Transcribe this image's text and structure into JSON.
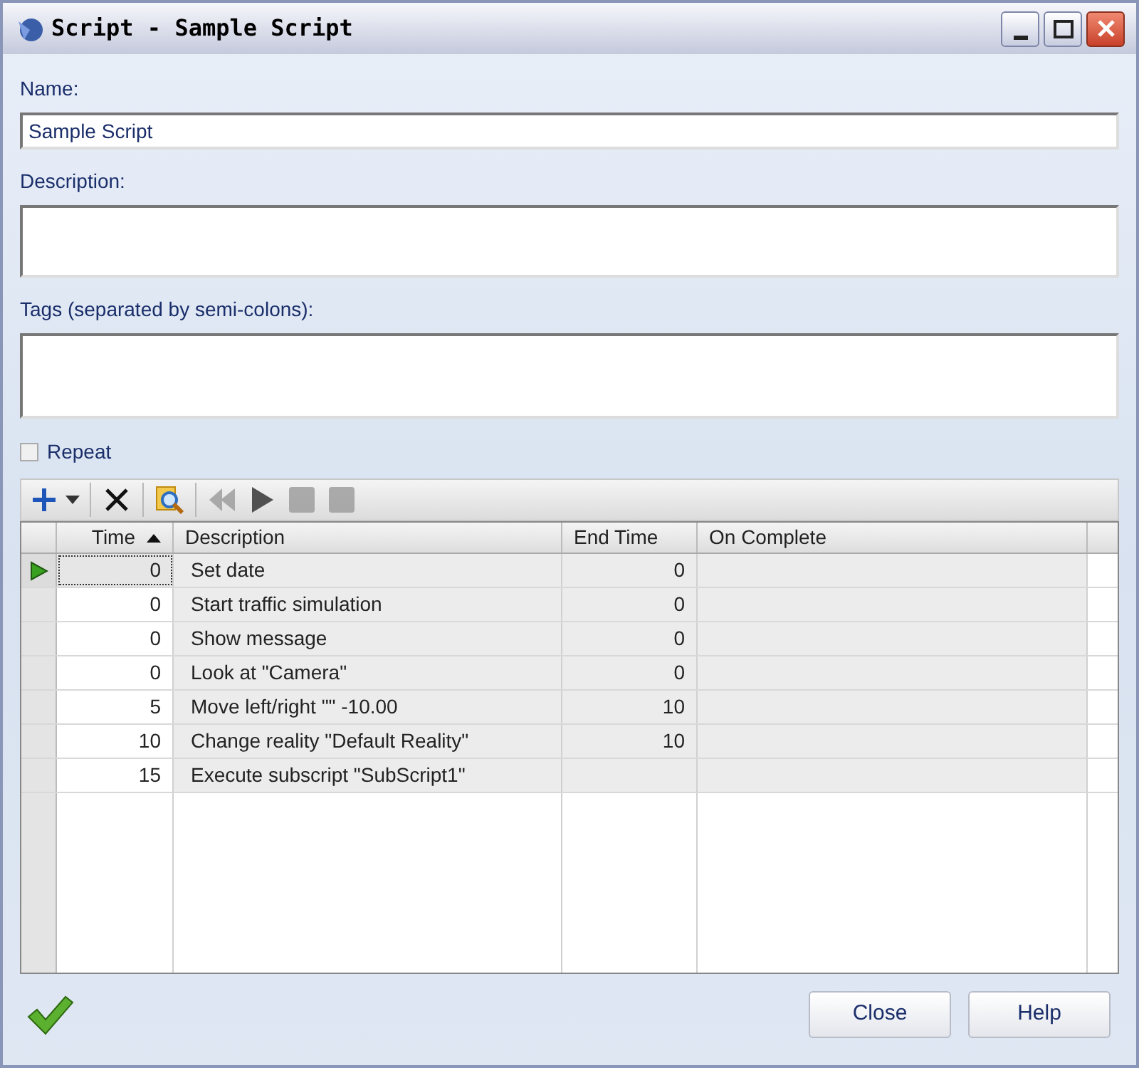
{
  "window": {
    "title": "Script - Sample Script"
  },
  "name": {
    "label": "Name:",
    "value": "Sample Script"
  },
  "description": {
    "label": "Description:"
  },
  "tags": {
    "label": "Tags (separated by semi-colons):"
  },
  "repeat": {
    "label": "Repeat",
    "checked": false
  },
  "toolbar": [
    {
      "kind": "add",
      "disabled": false
    },
    {
      "kind": "dropdown",
      "disabled": false
    },
    {
      "kind": "separator"
    },
    {
      "kind": "delete",
      "disabled": false
    },
    {
      "kind": "separator"
    },
    {
      "kind": "inspect",
      "disabled": false
    },
    {
      "kind": "separator"
    },
    {
      "kind": "rewind",
      "disabled": true
    },
    {
      "kind": "play",
      "disabled": false
    },
    {
      "kind": "stop",
      "disabled": true
    },
    {
      "kind": "pause",
      "disabled": true
    }
  ],
  "table": {
    "columns": [
      {
        "label": "Time",
        "sorted": true
      },
      {
        "label": "Description",
        "sorted": false
      },
      {
        "label": "End Time",
        "sorted": false
      },
      {
        "label": "On Complete",
        "sorted": false
      }
    ],
    "rows": [
      {
        "time": "0",
        "description": "Set date",
        "end_time": "0",
        "selected": true
      },
      {
        "time": "0",
        "description": "Start traffic simulation",
        "end_time": "0",
        "selected": false
      },
      {
        "time": "0",
        "description": "Show message",
        "end_time": "0",
        "selected": false
      },
      {
        "time": "0",
        "description": "Look at \"Camera\"",
        "end_time": "0",
        "selected": false
      },
      {
        "time": "5",
        "description": "Move left/right \"\" -10.00",
        "end_time": "10",
        "selected": false
      },
      {
        "time": "10",
        "description": "Change reality \"Default Reality\"",
        "end_time": "10",
        "selected": false
      },
      {
        "time": "15",
        "description": "Execute subscript \"SubScript1\"",
        "end_time": "",
        "selected": false
      }
    ]
  },
  "buttons": [
    "Close",
    "Help"
  ]
}
